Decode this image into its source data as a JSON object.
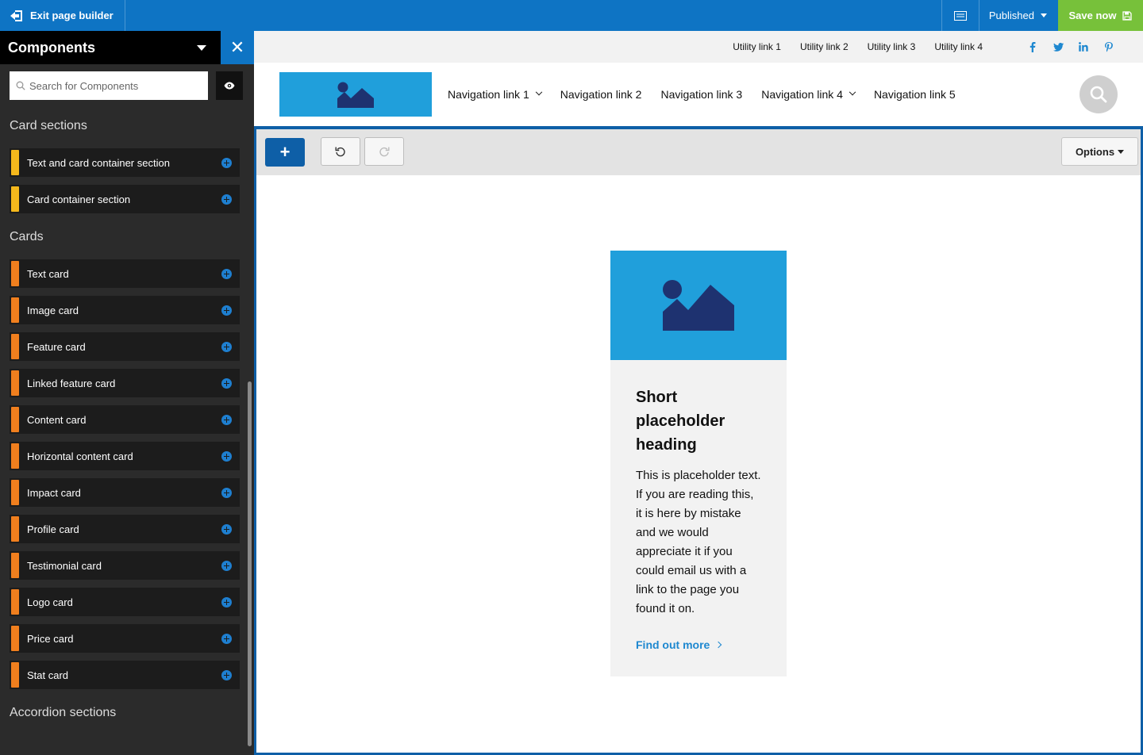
{
  "topbar": {
    "exit_label": "Exit page builder",
    "status_label": "Published",
    "save_label": "Save now"
  },
  "sidebar": {
    "title": "Components",
    "search_placeholder": "Search for Components",
    "sections": [
      {
        "title": "Card sections",
        "color": "#f5b81c",
        "items": [
          "Text and card container section",
          "Card container section"
        ]
      },
      {
        "title": "Cards",
        "color": "#f07f1e",
        "items": [
          "Text card",
          "Image card",
          "Feature card",
          "Linked feature card",
          "Content card",
          "Horizontal content card",
          "Impact card",
          "Profile card",
          "Testimonial card",
          "Logo card",
          "Price card",
          "Stat card"
        ]
      },
      {
        "title": "Accordion sections",
        "color": "#f5b81c",
        "items": []
      }
    ]
  },
  "site": {
    "utility_links": [
      "Utility link 1",
      "Utility link 2",
      "Utility link 3",
      "Utility link 4"
    ],
    "social_icons": [
      "facebook-icon",
      "twitter-icon",
      "linkedin-icon",
      "pinterest-icon"
    ],
    "nav_links": [
      {
        "label": "Navigation link 1",
        "dropdown": true
      },
      {
        "label": "Navigation link 2",
        "dropdown": false
      },
      {
        "label": "Navigation link 3",
        "dropdown": false
      },
      {
        "label": "Navigation link 4",
        "dropdown": true
      },
      {
        "label": "Navigation link 5",
        "dropdown": false
      }
    ]
  },
  "editor": {
    "options_label": "Options"
  },
  "card": {
    "heading": "Short placeholder heading",
    "text": "This is placeholder text. If you are reading this, it is here by mistake and we would appreciate it if you could email us with a link to the page you found it on.",
    "link_label": "Find out more"
  },
  "colors": {
    "brand_blue": "#0e74c4",
    "save_green": "#77c13a",
    "image_blue": "#209fdb",
    "image_navy": "#1e3270",
    "link_blue": "#1e88d0"
  }
}
